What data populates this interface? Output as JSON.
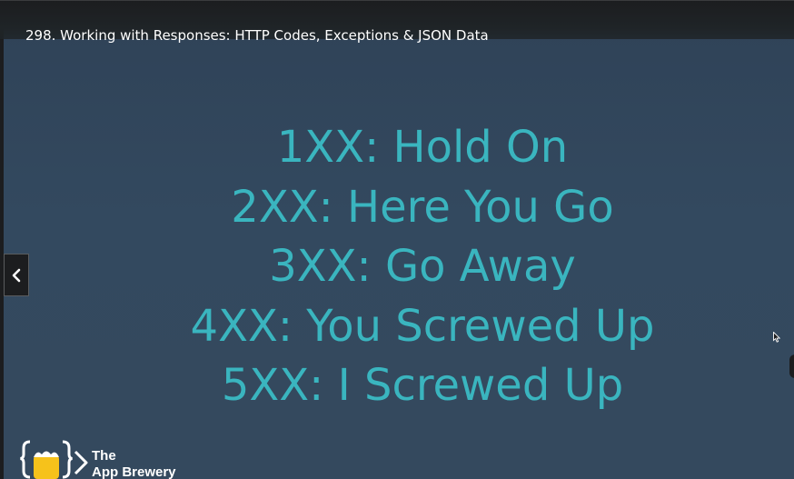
{
  "header": {
    "title": "298. Working with Responses: HTTP Codes, Exceptions & JSON Data"
  },
  "slide": {
    "lines": [
      "1XX: Hold On",
      "2XX: Here You Go",
      "3XX: Go Away",
      "4XX: You Screwed Up",
      "5XX: I Screwed Up"
    ]
  },
  "controls": {
    "prev_icon": "chevron-left-icon"
  },
  "brand": {
    "line1": "The",
    "line2": "App Brewery",
    "logo_icon": "beer-mug-braces-icon"
  },
  "colors": {
    "slide_text": "#3ab5bf",
    "slide_background": "#34495e",
    "header_background": "#1c1d1f",
    "brand_yellow": "#f6c21b"
  }
}
